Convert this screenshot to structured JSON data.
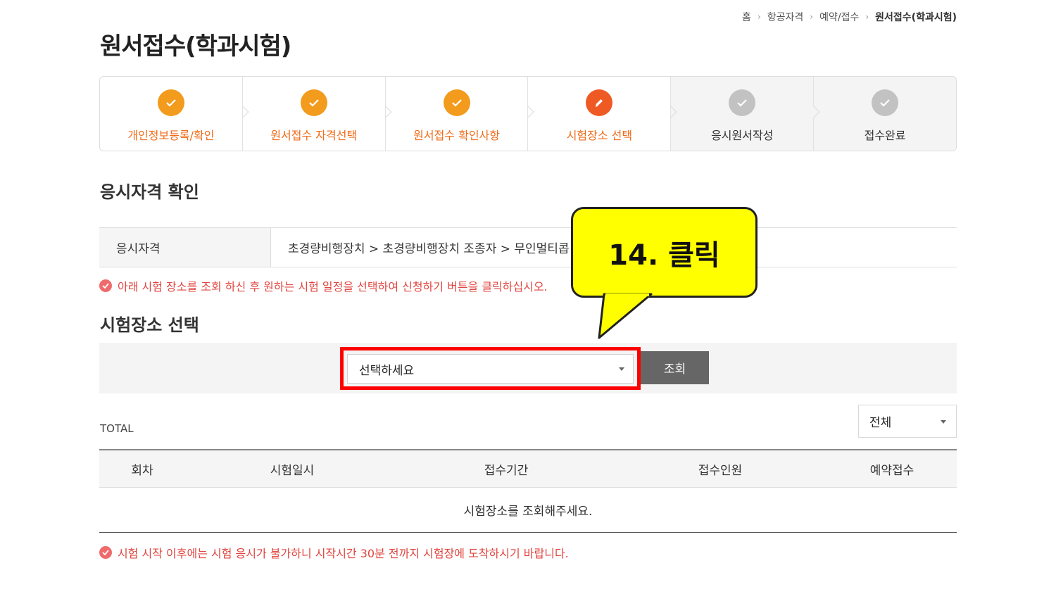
{
  "breadcrumb": {
    "home": "홈",
    "level1": "항공자격",
    "level2": "예약/접수",
    "current": "원서접수(학과시험)"
  },
  "page": {
    "title": "원서접수(학과시험)"
  },
  "steps": [
    {
      "label": "개인정보등록/확인",
      "status": "done"
    },
    {
      "label": "원서접수 자격선택",
      "status": "done"
    },
    {
      "label": "원서접수 확인사항",
      "status": "done"
    },
    {
      "label": "시험장소 선택",
      "status": "current"
    },
    {
      "label": "응시원서작성",
      "status": "todo"
    },
    {
      "label": "접수완료",
      "status": "todo"
    }
  ],
  "qualification": {
    "section_title": "응시자격 확인",
    "header": "응시자격",
    "value": "초경량비행장치 > 초경량비행장치 조종자 > 무인멀티콥"
  },
  "notice_top": "아래 시험 장소를 조회 하신 후 원하는 시험 일정을 선택하여 신청하기 버튼을 클릭하십시오.",
  "venue": {
    "section_title": "시험장소 선택",
    "select_value": "선택하세요",
    "search_label": "조회"
  },
  "results": {
    "total_label": "TOTAL",
    "filter_value": "전체",
    "columns": [
      "회차",
      "시험일시",
      "접수기간",
      "접수인원",
      "예약접수"
    ],
    "empty_message": "시험장소를 조회해주세요."
  },
  "notice_bottom": "시험 시작 이후에는 시험 응시가 불가하니 시작시간 30분 전까지 시험장에 도착하시기 바랍니다.",
  "callout": {
    "text": "14. 클릭"
  },
  "colors": {
    "done": "#f29b1d",
    "current": "#ef5a24",
    "todo": "#c2c2c2",
    "notice": "#e0453f",
    "highlight": "#ff0000",
    "callout": "#ffff00"
  }
}
